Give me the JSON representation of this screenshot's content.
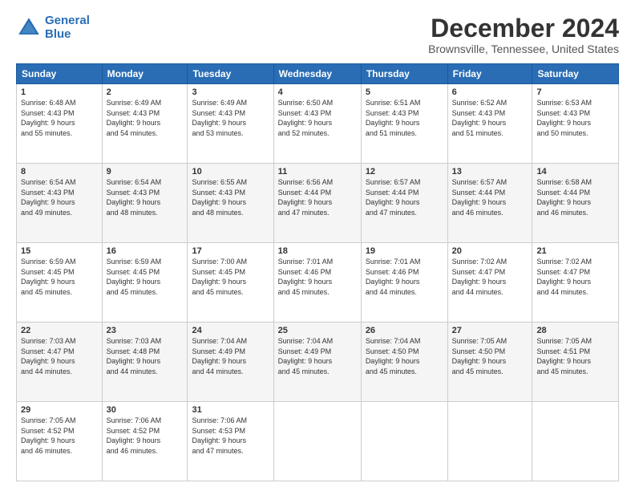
{
  "header": {
    "logo_line1": "General",
    "logo_line2": "Blue",
    "title": "December 2024",
    "location": "Brownsville, Tennessee, United States"
  },
  "columns": [
    "Sunday",
    "Monday",
    "Tuesday",
    "Wednesday",
    "Thursday",
    "Friday",
    "Saturday"
  ],
  "weeks": [
    [
      {
        "day": "1",
        "lines": [
          "Sunrise: 6:48 AM",
          "Sunset: 4:43 PM",
          "Daylight: 9 hours",
          "and 55 minutes."
        ]
      },
      {
        "day": "2",
        "lines": [
          "Sunrise: 6:49 AM",
          "Sunset: 4:43 PM",
          "Daylight: 9 hours",
          "and 54 minutes."
        ]
      },
      {
        "day": "3",
        "lines": [
          "Sunrise: 6:49 AM",
          "Sunset: 4:43 PM",
          "Daylight: 9 hours",
          "and 53 minutes."
        ]
      },
      {
        "day": "4",
        "lines": [
          "Sunrise: 6:50 AM",
          "Sunset: 4:43 PM",
          "Daylight: 9 hours",
          "and 52 minutes."
        ]
      },
      {
        "day": "5",
        "lines": [
          "Sunrise: 6:51 AM",
          "Sunset: 4:43 PM",
          "Daylight: 9 hours",
          "and 51 minutes."
        ]
      },
      {
        "day": "6",
        "lines": [
          "Sunrise: 6:52 AM",
          "Sunset: 4:43 PM",
          "Daylight: 9 hours",
          "and 51 minutes."
        ]
      },
      {
        "day": "7",
        "lines": [
          "Sunrise: 6:53 AM",
          "Sunset: 4:43 PM",
          "Daylight: 9 hours",
          "and 50 minutes."
        ]
      }
    ],
    [
      {
        "day": "8",
        "lines": [
          "Sunrise: 6:54 AM",
          "Sunset: 4:43 PM",
          "Daylight: 9 hours",
          "and 49 minutes."
        ]
      },
      {
        "day": "9",
        "lines": [
          "Sunrise: 6:54 AM",
          "Sunset: 4:43 PM",
          "Daylight: 9 hours",
          "and 48 minutes."
        ]
      },
      {
        "day": "10",
        "lines": [
          "Sunrise: 6:55 AM",
          "Sunset: 4:43 PM",
          "Daylight: 9 hours",
          "and 48 minutes."
        ]
      },
      {
        "day": "11",
        "lines": [
          "Sunrise: 6:56 AM",
          "Sunset: 4:44 PM",
          "Daylight: 9 hours",
          "and 47 minutes."
        ]
      },
      {
        "day": "12",
        "lines": [
          "Sunrise: 6:57 AM",
          "Sunset: 4:44 PM",
          "Daylight: 9 hours",
          "and 47 minutes."
        ]
      },
      {
        "day": "13",
        "lines": [
          "Sunrise: 6:57 AM",
          "Sunset: 4:44 PM",
          "Daylight: 9 hours",
          "and 46 minutes."
        ]
      },
      {
        "day": "14",
        "lines": [
          "Sunrise: 6:58 AM",
          "Sunset: 4:44 PM",
          "Daylight: 9 hours",
          "and 46 minutes."
        ]
      }
    ],
    [
      {
        "day": "15",
        "lines": [
          "Sunrise: 6:59 AM",
          "Sunset: 4:45 PM",
          "Daylight: 9 hours",
          "and 45 minutes."
        ]
      },
      {
        "day": "16",
        "lines": [
          "Sunrise: 6:59 AM",
          "Sunset: 4:45 PM",
          "Daylight: 9 hours",
          "and 45 minutes."
        ]
      },
      {
        "day": "17",
        "lines": [
          "Sunrise: 7:00 AM",
          "Sunset: 4:45 PM",
          "Daylight: 9 hours",
          "and 45 minutes."
        ]
      },
      {
        "day": "18",
        "lines": [
          "Sunrise: 7:01 AM",
          "Sunset: 4:46 PM",
          "Daylight: 9 hours",
          "and 45 minutes."
        ]
      },
      {
        "day": "19",
        "lines": [
          "Sunrise: 7:01 AM",
          "Sunset: 4:46 PM",
          "Daylight: 9 hours",
          "and 44 minutes."
        ]
      },
      {
        "day": "20",
        "lines": [
          "Sunrise: 7:02 AM",
          "Sunset: 4:47 PM",
          "Daylight: 9 hours",
          "and 44 minutes."
        ]
      },
      {
        "day": "21",
        "lines": [
          "Sunrise: 7:02 AM",
          "Sunset: 4:47 PM",
          "Daylight: 9 hours",
          "and 44 minutes."
        ]
      }
    ],
    [
      {
        "day": "22",
        "lines": [
          "Sunrise: 7:03 AM",
          "Sunset: 4:47 PM",
          "Daylight: 9 hours",
          "and 44 minutes."
        ]
      },
      {
        "day": "23",
        "lines": [
          "Sunrise: 7:03 AM",
          "Sunset: 4:48 PM",
          "Daylight: 9 hours",
          "and 44 minutes."
        ]
      },
      {
        "day": "24",
        "lines": [
          "Sunrise: 7:04 AM",
          "Sunset: 4:49 PM",
          "Daylight: 9 hours",
          "and 44 minutes."
        ]
      },
      {
        "day": "25",
        "lines": [
          "Sunrise: 7:04 AM",
          "Sunset: 4:49 PM",
          "Daylight: 9 hours",
          "and 45 minutes."
        ]
      },
      {
        "day": "26",
        "lines": [
          "Sunrise: 7:04 AM",
          "Sunset: 4:50 PM",
          "Daylight: 9 hours",
          "and 45 minutes."
        ]
      },
      {
        "day": "27",
        "lines": [
          "Sunrise: 7:05 AM",
          "Sunset: 4:50 PM",
          "Daylight: 9 hours",
          "and 45 minutes."
        ]
      },
      {
        "day": "28",
        "lines": [
          "Sunrise: 7:05 AM",
          "Sunset: 4:51 PM",
          "Daylight: 9 hours",
          "and 45 minutes."
        ]
      }
    ],
    [
      {
        "day": "29",
        "lines": [
          "Sunrise: 7:05 AM",
          "Sunset: 4:52 PM",
          "Daylight: 9 hours",
          "and 46 minutes."
        ]
      },
      {
        "day": "30",
        "lines": [
          "Sunrise: 7:06 AM",
          "Sunset: 4:52 PM",
          "Daylight: 9 hours",
          "and 46 minutes."
        ]
      },
      {
        "day": "31",
        "lines": [
          "Sunrise: 7:06 AM",
          "Sunset: 4:53 PM",
          "Daylight: 9 hours",
          "and 47 minutes."
        ]
      },
      null,
      null,
      null,
      null
    ]
  ]
}
